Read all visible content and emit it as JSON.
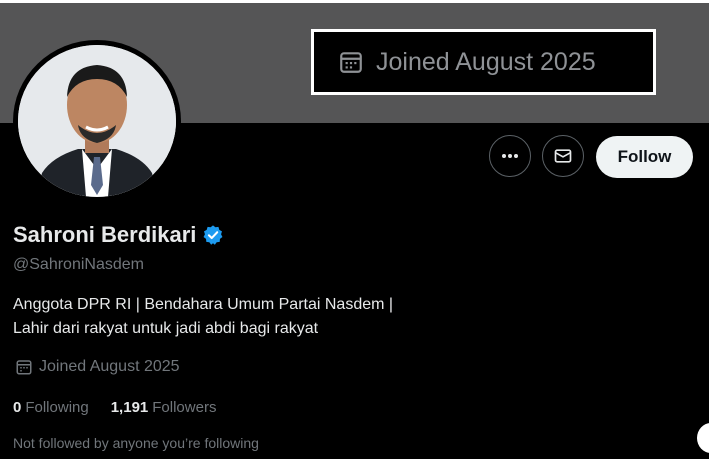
{
  "banner_callout": {
    "text": "Joined August 2025",
    "icon": "calendar-icon"
  },
  "profile": {
    "name": "Sahroni Berdikari",
    "verified_icon": "verified-badge-icon",
    "handle": "@SahroniNasdem",
    "bio_lines": [
      "Anggota DPR RI | Bendahara Umum Partai Nasdem |",
      "Lahir dari rakyat untuk jadi abdi bagi rakyat"
    ],
    "joined": "Joined August 2025",
    "following_count": "0",
    "following_label": "Following",
    "followers_count": "1,191",
    "followers_label": "Followers",
    "not_followed": "Not followed by anyone you’re following"
  },
  "actions": {
    "more_icon": "more-icon",
    "message_icon": "mail-icon",
    "follow_label": "Follow"
  },
  "colors": {
    "background": "#000000",
    "banner": "#555556",
    "text_primary": "#e7e9ea",
    "text_secondary": "#71767b",
    "verified": "#1d9bf0",
    "follow_bg": "#eff3f4"
  }
}
